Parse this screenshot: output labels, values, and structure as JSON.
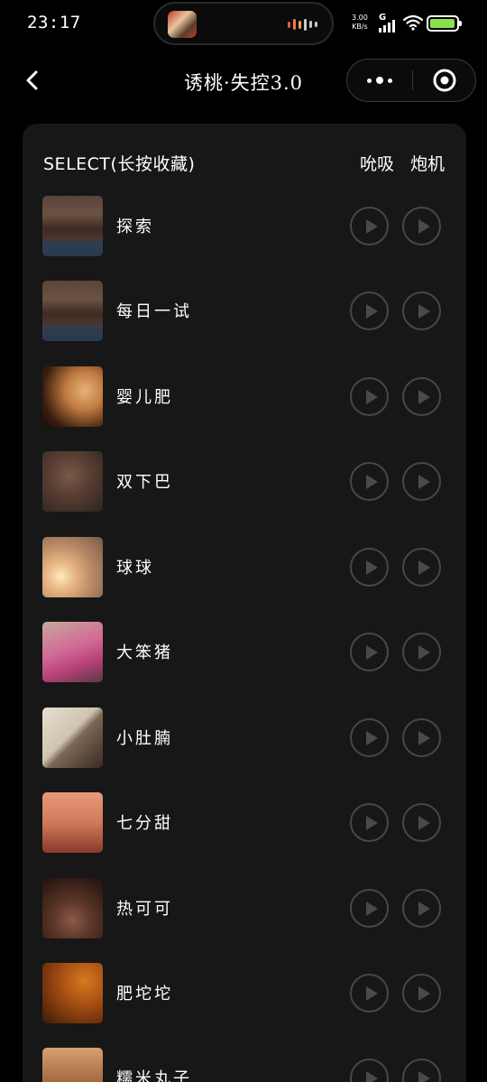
{
  "status_bar": {
    "time": "23:17",
    "net_speed_value": "3.00",
    "net_speed_unit": "KB/s",
    "network_type": "G",
    "battery_level": 0.95,
    "battery_color": "#8be04e"
  },
  "nav": {
    "title": "诱桃·失控3.0",
    "back_icon": "chevron-left-icon",
    "more_icon": "more-dots-icon",
    "close_icon": "target-circle-icon"
  },
  "list": {
    "header_label": "SELECT(长按收藏)",
    "column_a": "吮吸",
    "column_b": "炮机",
    "play_icon": "play-icon",
    "items": [
      {
        "label": "探索"
      },
      {
        "label": "每日一试"
      },
      {
        "label": "婴儿肥"
      },
      {
        "label": "双下巴"
      },
      {
        "label": "球球"
      },
      {
        "label": "大笨猪"
      },
      {
        "label": "小肚腩"
      },
      {
        "label": "七分甜"
      },
      {
        "label": "热可可"
      },
      {
        "label": "肥坨坨"
      },
      {
        "label": "糯米丸子"
      }
    ]
  }
}
